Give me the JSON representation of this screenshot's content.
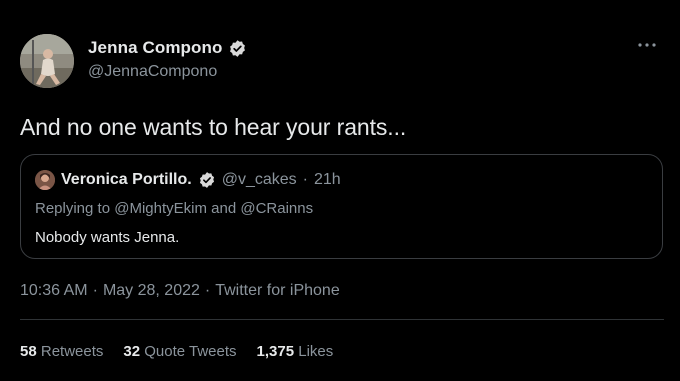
{
  "author": {
    "name": "Jenna Compono",
    "handle": "@JennaCompono",
    "verified": true
  },
  "tweet": {
    "text": "And no one wants to hear your rants..."
  },
  "quote": {
    "name": "Veronica Portillo.",
    "handle": "@v_cakes",
    "dot": "·",
    "time": "21h",
    "replying_prefix": "Replying to",
    "replying_to_1": "@MightyEkim",
    "replying_and": "and",
    "replying_to_2": "@CRainns",
    "text": "Nobody wants Jenna."
  },
  "meta": {
    "time": "10:36 AM",
    "sep1": "·",
    "date": "May 28, 2022",
    "sep2": "·",
    "source": "Twitter for iPhone"
  },
  "stats": {
    "retweets_count": "58",
    "retweets_label": "Retweets",
    "quotes_count": "32",
    "quotes_label": "Quote Tweets",
    "likes_count": "1,375",
    "likes_label": "Likes"
  },
  "colors": {
    "background": "#000000",
    "primary_text": "#e7e9ea",
    "secondary_text": "#8b949c",
    "verified_badge": "#d9d9d9",
    "border": "#3a3d41"
  },
  "icons": {
    "more": "more-horizontal-icon",
    "verified": "verified-badge-icon"
  }
}
